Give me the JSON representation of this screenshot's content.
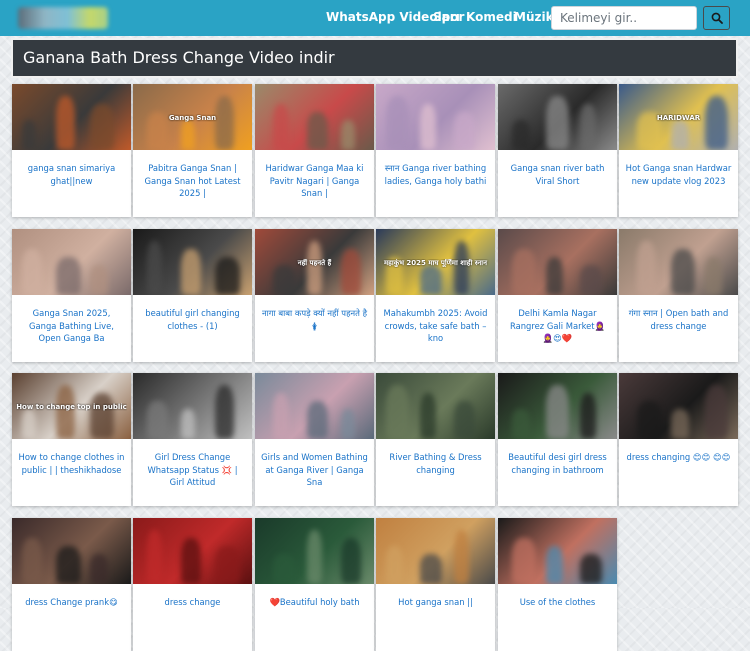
{
  "nav": {
    "links": [
      "WhatsApp Videoları",
      "Spor",
      "Komedi",
      "Müzik"
    ],
    "search_placeholder": "Kelimeyi gir.."
  },
  "page": {
    "title": "Ganana Bath Dress Change Video indir"
  },
  "colors": {
    "navbar": "#2aa3c5",
    "title_bg": "#343a40",
    "link": "#1a73c8"
  },
  "videos": [
    {
      "title": "ganga snan simariya ghat||new",
      "thumb_tone": [
        "#7a4a2c",
        "#3a3a3a",
        "#c05a2a"
      ],
      "overlay_text": ""
    },
    {
      "title": "Pabitra Ganga Snan | Ganga Snan hot Latest 2025 |",
      "thumb_tone": [
        "#8a6a4a",
        "#c8824a",
        "#f0a020"
      ],
      "overlay_text": "Ganga Snan"
    },
    {
      "title": "Haridwar Ganga Maa ki Pavitr Nagari | Ganga Snan |",
      "thumb_tone": [
        "#9a8a6a",
        "#c84a4a",
        "#6a5a4a"
      ],
      "overlay_text": ""
    },
    {
      "title": "स्नान Ganga river bathing ladies, Ganga holy bathi",
      "thumb_tone": [
        "#c8a8c8",
        "#a890b8",
        "#e0c0d0"
      ],
      "overlay_text": ""
    },
    {
      "title": "Ganga snan river bath Viral Short",
      "thumb_tone": [
        "#6a6a6a",
        "#2a2a2a",
        "#8a8a8a"
      ],
      "overlay_text": ""
    },
    {
      "title": "Hot Ganga snan Hardwar new update vlog 2023",
      "thumb_tone": [
        "#3a5a8a",
        "#e0c050",
        "#b0b0b0"
      ],
      "overlay_text": "HARIDWAR"
    },
    {
      "title": "Ganga Snan 2025, Ganga Bathing Live, Open Ganga Ba",
      "thumb_tone": [
        "#b09080",
        "#d0b0a0",
        "#7a6a6a"
      ],
      "overlay_text": ""
    },
    {
      "title": "beautiful girl changing clothes - (1)",
      "thumb_tone": [
        "#1a1a1a",
        "#4a4a4a",
        "#c8a070"
      ],
      "overlay_text": ""
    },
    {
      "title": "नागा बाबा कपड़े क्यों नहीं पहनते है🛊",
      "thumb_tone": [
        "#a04a3a",
        "#3a3a3a",
        "#d0a080"
      ],
      "overlay_text": "नहीं पहनते हैं"
    },
    {
      "title": "Mahakumbh 2025: Avoid crowds, take safe bath – kno",
      "thumb_tone": [
        "#2a3a5a",
        "#e0c040",
        "#4a6a8a"
      ],
      "overlay_text": "महाकुंभ 2025 माघ पूर्णिमा शाही स्नान"
    },
    {
      "title": "Delhi Kamla Nagar Rangrez Gali Market🧕 🧕😍❤️",
      "thumb_tone": [
        "#5a4a4a",
        "#a87060",
        "#3a3a3a"
      ],
      "overlay_text": ""
    },
    {
      "title": "गंगा स्नान | Open bath and dress change",
      "thumb_tone": [
        "#8a7a6a",
        "#c0a090",
        "#4a4a4a"
      ],
      "overlay_text": ""
    },
    {
      "title": "How to change clothes in public | | theshikhadose",
      "thumb_tone": [
        "#5a4030",
        "#d8d0c8",
        "#8a6040"
      ],
      "overlay_text": "How to change top in public"
    },
    {
      "title": "Girl Dress Change Whatsapp Status 💢 | Girl Attitud",
      "thumb_tone": [
        "#2a2a2a",
        "#7a7a7a",
        "#c0c0c0"
      ],
      "overlay_text": ""
    },
    {
      "title": "Girls and Women Bathing at Ganga River | Ganga Sna",
      "thumb_tone": [
        "#7a8a9a",
        "#c8a0b0",
        "#5a6a7a"
      ],
      "overlay_text": ""
    },
    {
      "title": "River Bathing & Dress changing",
      "thumb_tone": [
        "#3a4a3a",
        "#6a7a5a",
        "#2a3a2a"
      ],
      "overlay_text": ""
    },
    {
      "title": "Beautiful desi girl dress changing in bathroom",
      "thumb_tone": [
        "#1a1a1a",
        "#3a5a3a",
        "#8a8a8a"
      ],
      "overlay_text": ""
    },
    {
      "title": "dress changing 😊😊 😊😊",
      "thumb_tone": [
        "#4a3a3a",
        "#1a1a1a",
        "#7a6a5a"
      ],
      "overlay_text": ""
    },
    {
      "title": "dress Change prank😋",
      "thumb_tone": [
        "#3a2a2a",
        "#7a5a4a",
        "#1a1a1a"
      ],
      "overlay_text": ""
    },
    {
      "title": "dress change",
      "thumb_tone": [
        "#8a1a1a",
        "#c02a2a",
        "#5a1010"
      ],
      "overlay_text": ""
    },
    {
      "title": "❤️Beautiful holy bath",
      "thumb_tone": [
        "#1a3a2a",
        "#2a5a3a",
        "#6a8a6a"
      ],
      "overlay_text": ""
    },
    {
      "title": "Hot ganga snan ||",
      "thumb_tone": [
        "#c08040",
        "#d0a060",
        "#4a4a4a"
      ],
      "overlay_text": ""
    },
    {
      "title": "Use of the clothes",
      "thumb_tone": [
        "#1a1a1a",
        "#c07060",
        "#4a8ab0"
      ],
      "overlay_text": ""
    }
  ]
}
